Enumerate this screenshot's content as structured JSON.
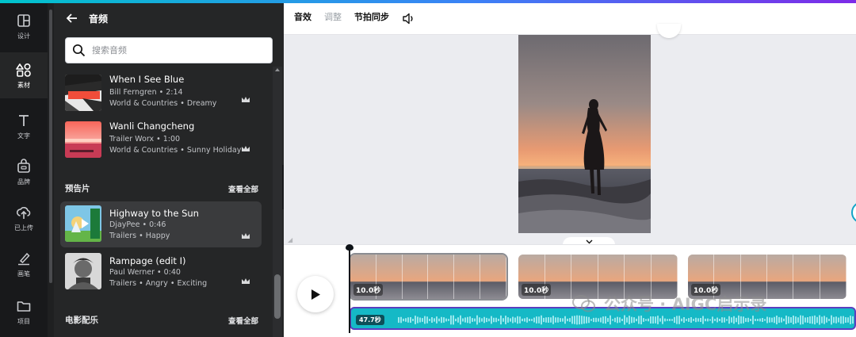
{
  "rail": {
    "items": [
      {
        "label": "设计",
        "icon": "layout-icon"
      },
      {
        "label": "素材",
        "icon": "elements-icon"
      },
      {
        "label": "文字",
        "icon": "text-icon"
      },
      {
        "label": "品牌",
        "icon": "brand-icon"
      },
      {
        "label": "已上传",
        "icon": "upload-icon"
      },
      {
        "label": "画笔",
        "icon": "draw-icon"
      },
      {
        "label": "项目",
        "icon": "folder-icon"
      }
    ]
  },
  "panel": {
    "title": "音频",
    "search_placeholder": "搜索音频",
    "tracks_top": [
      {
        "title": "When I See Blue",
        "artist_duration": "Bill Ferngren • 2:14",
        "tags": "World & Countries • Dreamy"
      },
      {
        "title": "Wanli Changcheng",
        "artist_duration": "Trailer Worx • 1:00",
        "tags": "World & Countries • Sunny Holiday"
      }
    ],
    "sections": [
      {
        "title": "预告片",
        "link": "查看全部"
      },
      {
        "title": "电影配乐",
        "link": "查看全部"
      }
    ],
    "tracks_trailer": [
      {
        "title": "Highway to the Sun",
        "artist_duration": "DjayPee • 0:46",
        "tags": "Trailers • Happy"
      },
      {
        "title": "Rampage (edit I)",
        "artist_duration": "Paul Werner • 0:40",
        "tags": "Trailers • Angry • Exciting"
      }
    ]
  },
  "toolbar": {
    "effects": "音效",
    "adjust": "调整",
    "beat_sync": "节拍同步"
  },
  "timeline": {
    "clips": [
      {
        "duration": "10.0秒"
      },
      {
        "duration": "10.0秒"
      },
      {
        "duration": "10.0秒"
      }
    ],
    "audio_duration": "47.7秒"
  },
  "watermark": "公众号 · AIGC启示录",
  "colors": {
    "accent": "#15b9c6",
    "selection": "#5a3fc0",
    "panel_bg": "#252627",
    "rail_bg": "#18191b"
  }
}
